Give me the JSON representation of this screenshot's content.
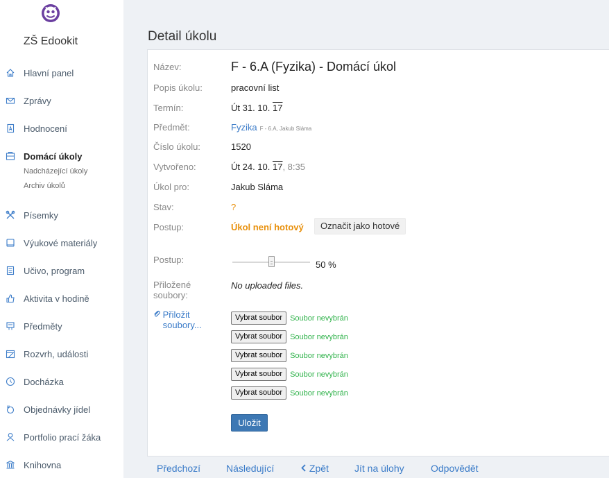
{
  "sidebar": {
    "school_name": "ZŠ Edookit",
    "logo_icon": "owl-logo",
    "items": [
      {
        "label": "Hlavní panel",
        "icon": "home-icon"
      },
      {
        "label": "Zprávy",
        "icon": "envelope-icon"
      },
      {
        "label": "Hodnocení",
        "icon": "grade-document-icon"
      },
      {
        "label": "Domácí úkoly",
        "icon": "homework-icon",
        "active": true
      },
      {
        "label": "Písemky",
        "icon": "tools-icon"
      },
      {
        "label": "Výukové materiály",
        "icon": "book-icon"
      },
      {
        "label": "Učivo, program",
        "icon": "list-document-icon"
      },
      {
        "label": "Aktivita v hodině",
        "icon": "thumbs-up-icon"
      },
      {
        "label": "Předměty",
        "icon": "subjects-icon"
      },
      {
        "label": "Rozvrh, události",
        "icon": "calendar-icon"
      },
      {
        "label": "Docházka",
        "icon": "clock-icon"
      },
      {
        "label": "Objednávky jídel",
        "icon": "meal-icon"
      },
      {
        "label": "Portfolio prací žáka",
        "icon": "person-icon"
      },
      {
        "label": "Knihovna",
        "icon": "library-icon"
      }
    ],
    "sub_items": [
      "Nadcházející úkoly",
      "Archiv úkolů"
    ]
  },
  "page": {
    "title": "Detail úkolu"
  },
  "detail": {
    "name_label": "Název:",
    "name_value": "F - 6.A (Fyzika) - Domácí úkol",
    "desc_label": "Popis úkolu:",
    "desc_value": "pracovní list",
    "deadline_label": "Termín:",
    "deadline_prefix": "Út 31. 10. ",
    "deadline_year": "17",
    "subject_label": "Předmět:",
    "subject_link": "Fyzika",
    "subject_detail": "F - 6.A, Jakub Sláma",
    "number_label": "Číslo úkolu:",
    "number_value": "1520",
    "created_label": "Vytvořeno:",
    "created_prefix": "Út 24. 10. ",
    "created_year": "17",
    "created_time": ", 8:35",
    "for_label": "Úkol pro:",
    "for_value": "Jakub Sláma",
    "state_label": "Stav:",
    "state_value": "?",
    "progress_label": "Postup:",
    "progress_status": "Úkol není hotový",
    "mark_done_button": "Označit jako hotové",
    "progress2_label": "Postup:",
    "progress_value": 50,
    "progress_text": "50 %",
    "attached_label": "Přiložené soubory:",
    "attached_value": "No uploaded files.",
    "attach_link": "Přiložit soubory...",
    "attach_icon": "paperclip-icon",
    "file_button": "Vybrat soubor",
    "file_status": "Soubor nevybrán",
    "file_rows": 5,
    "save_button": "Uložit"
  },
  "bottom_nav": {
    "prev": "Předchozí",
    "next": "Následující",
    "back": "Zpět",
    "back_icon": "chevron-left-icon",
    "go_tasks": "Jít na úlohy",
    "reply": "Odpovědět"
  },
  "colors": {
    "accent": "#3a7bc8",
    "warning": "#e8900c",
    "success": "#2fb24a",
    "primary_button": "#3d78b4",
    "logo": "#6b3fa0"
  }
}
